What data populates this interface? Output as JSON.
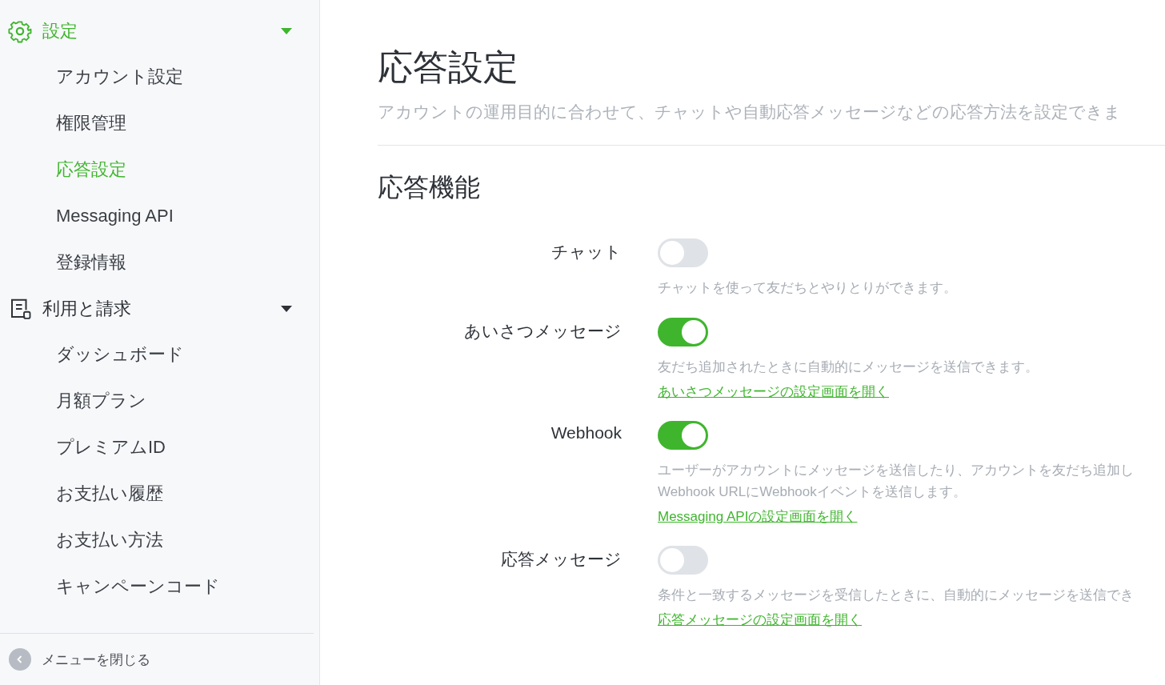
{
  "sidebar": {
    "groups": [
      {
        "label": "設定",
        "kind": "gear",
        "selected": true,
        "expanded": true,
        "items": [
          {
            "label": "アカウント設定",
            "selected": false
          },
          {
            "label": "権限管理",
            "selected": false
          },
          {
            "label": "応答設定",
            "selected": true
          },
          {
            "label": "Messaging API",
            "selected": false
          },
          {
            "label": "登録情報",
            "selected": false
          }
        ]
      },
      {
        "label": "利用と請求",
        "kind": "document",
        "selected": false,
        "expanded": true,
        "items": [
          {
            "label": "ダッシュボード",
            "selected": false
          },
          {
            "label": "月額プラン",
            "selected": false
          },
          {
            "label": "プレミアムID",
            "selected": false
          },
          {
            "label": "お支払い履歴",
            "selected": false
          },
          {
            "label": "お支払い方法",
            "selected": false
          },
          {
            "label": "キャンペーンコード",
            "selected": false
          }
        ]
      }
    ],
    "close_menu": "メニューを閉じる"
  },
  "page": {
    "title": "応答設定",
    "subtitle": "アカウントの運用目的に合わせて、チャットや自動応答メッセージなどの応答方法を設定できま"
  },
  "section": {
    "title": "応答機能",
    "features": [
      {
        "label": "チャット",
        "on": false,
        "description": [
          "チャットを使って友だちとやりとりができます。"
        ]
      },
      {
        "label": "あいさつメッセージ",
        "on": true,
        "description": [
          "友だち追加されたときに自動的にメッセージを送信できます。"
        ],
        "link": "あいさつメッセージの設定画面を開く"
      },
      {
        "label": "Webhook",
        "on": true,
        "description": [
          "ユーザーがアカウントにメッセージを送信したり、アカウントを友だち追加し",
          "Webhook URLにWebhookイベントを送信します。"
        ],
        "link": "Messaging APIの設定画面を開く"
      },
      {
        "label": "応答メッセージ",
        "on": false,
        "description": [
          "条件と一致するメッセージを受信したときに、自動的にメッセージを送信でき"
        ],
        "link": "応答メッセージの設定画面を開く"
      }
    ]
  }
}
